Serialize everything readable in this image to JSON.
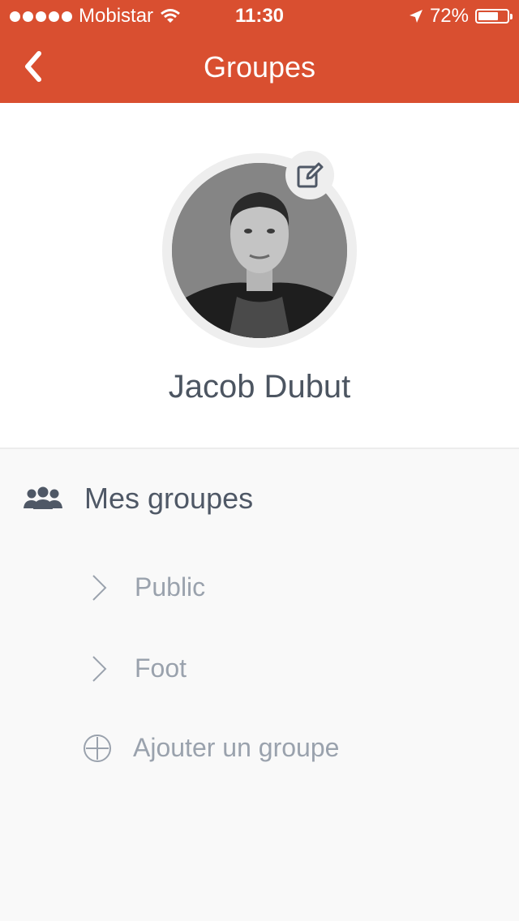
{
  "status_bar": {
    "carrier": "Mobistar",
    "time": "11:30",
    "battery_percent_label": "72%",
    "battery_level": 0.72
  },
  "nav": {
    "title": "Groupes",
    "back_icon": "chevron-left-icon"
  },
  "profile": {
    "name": "Jacob Dubut",
    "edit_icon": "edit-icon"
  },
  "groups": {
    "section_title": "Mes groupes",
    "section_icon": "users-icon",
    "items": [
      {
        "label": "Public"
      },
      {
        "label": "Foot"
      }
    ],
    "add_label": "Ajouter un groupe"
  },
  "colors": {
    "accent": "#d94f30",
    "text_dark": "#4f5866",
    "text_muted": "#9aa2ad"
  }
}
